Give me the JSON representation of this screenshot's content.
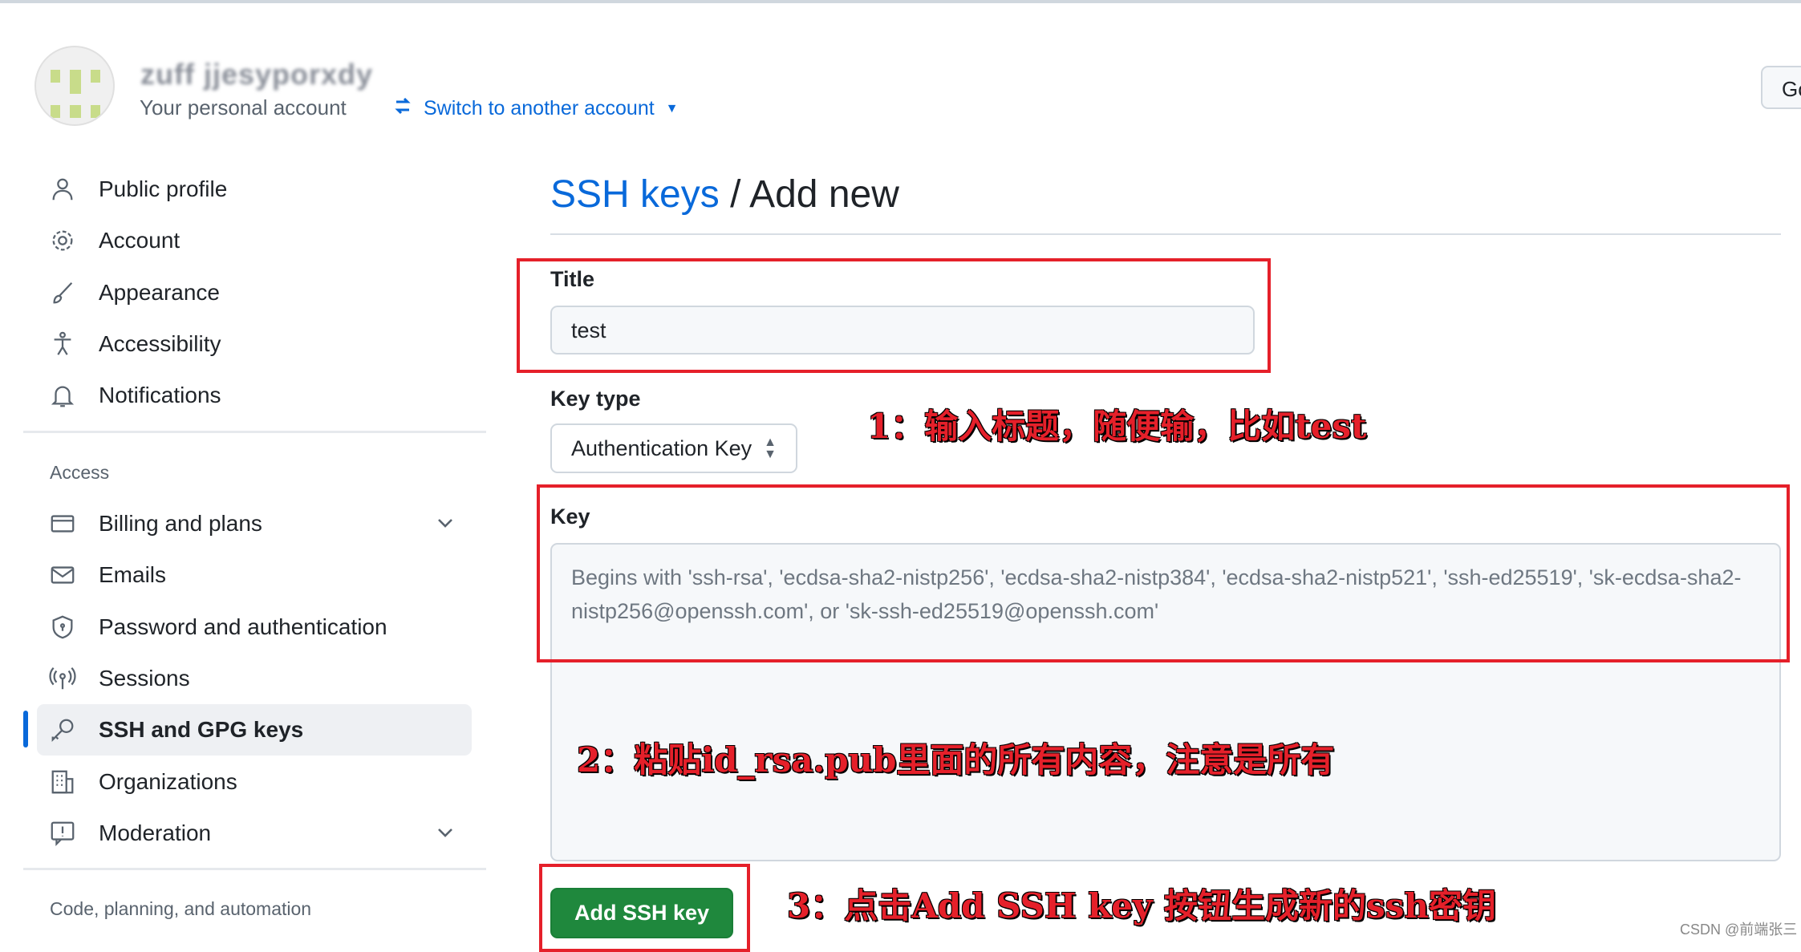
{
  "header": {
    "account_name": "zuff jjesyporxdy",
    "account_subtitle": "Your personal account",
    "switch_link": "Switch to another account",
    "right_button": "Go"
  },
  "sidebar": {
    "items": [
      {
        "label": "Public profile",
        "icon": "person-icon"
      },
      {
        "label": "Account",
        "icon": "gear-icon"
      },
      {
        "label": "Appearance",
        "icon": "paintbrush-icon"
      },
      {
        "label": "Accessibility",
        "icon": "accessibility-icon"
      },
      {
        "label": "Notifications",
        "icon": "bell-icon"
      }
    ],
    "access_heading": "Access",
    "access_items": [
      {
        "label": "Billing and plans",
        "icon": "credit-card-icon",
        "expandable": true
      },
      {
        "label": "Emails",
        "icon": "mail-icon"
      },
      {
        "label": "Password and authentication",
        "icon": "shield-icon"
      },
      {
        "label": "Sessions",
        "icon": "broadcast-icon"
      },
      {
        "label": "SSH and GPG keys",
        "icon": "key-icon",
        "selected": true
      },
      {
        "label": "Organizations",
        "icon": "organization-icon"
      },
      {
        "label": "Moderation",
        "icon": "report-icon",
        "expandable": true
      }
    ],
    "code_heading": "Code, planning, and automation"
  },
  "main": {
    "breadcrumb_link": "SSH keys",
    "breadcrumb_sep": " / ",
    "title": "Add new",
    "title_label": "Title",
    "title_value": "test",
    "keytype_label": "Key type",
    "keytype_value": "Authentication Key",
    "key_label": "Key",
    "key_placeholder": "Begins with 'ssh-rsa', 'ecdsa-sha2-nistp256', 'ecdsa-sha2-nistp384', 'ecdsa-sha2-nistp521', 'ssh-ed25519', 'sk-ecdsa-sha2-nistp256@openssh.com', or 'sk-ssh-ed25519@openssh.com'",
    "submit": "Add SSH key"
  },
  "annotations": {
    "a1": "1：输入标题，随便输，比如test",
    "a2": "2：粘贴id_rsa.pub里面的所有内容，注意是所有",
    "a3": "3：点击Add SSH key 按钮生成新的ssh密钥",
    "color": "#e5202a"
  },
  "watermark": "CSDN @前端张三",
  "colors": {
    "accent": "#0969da",
    "primary_button": "#1f883d"
  }
}
